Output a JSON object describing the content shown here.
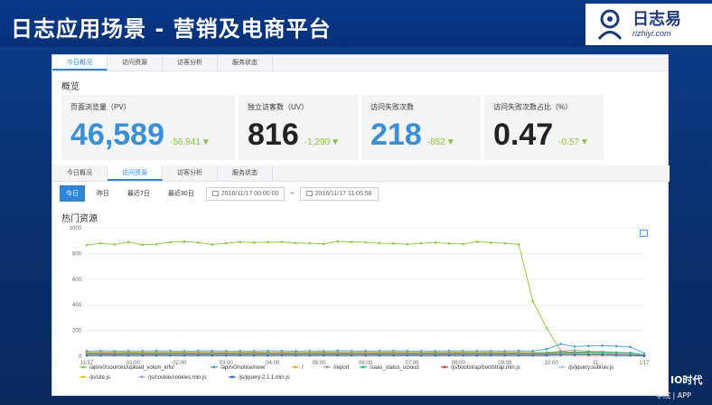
{
  "slide": {
    "title": "日志应用场景 - 营销及电商平台",
    "logo_main": "日志易",
    "logo_sub": "rizhiyi.com",
    "corner_text": "IO时代",
    "corner_sub": "学院 | APP"
  },
  "tabs": [
    "今日概况",
    "访问资源",
    "访客分析",
    "服务状态"
  ],
  "tabs_active": 0,
  "overview_title": "概览",
  "metrics": [
    {
      "label": "页面浏览量（PV）",
      "value": "46,589",
      "delta": "-56,941",
      "color": "#3a8fd6"
    },
    {
      "label": "独立访客数（UV）",
      "value": "816",
      "delta": "-1,290",
      "color": "#222222"
    },
    {
      "label": "访问失败次数",
      "value": "218",
      "delta": "-852",
      "color": "#3a8fd6"
    },
    {
      "label": "访问失败次数占比（%）",
      "value": "0.47",
      "delta": "-0.57",
      "color": "#222222"
    }
  ],
  "tabs2": [
    "今日概况",
    "访问资源",
    "访客分析",
    "服务状态"
  ],
  "tabs2_active": 1,
  "filters": {
    "today": "今日",
    "yesterday": "昨日",
    "last7": "最近7日",
    "last30": "最近30日",
    "from": "2016/11/17 00:00:00",
    "sep": "~",
    "to": "2016/11/17 11:05:58"
  },
  "chart_title": "热门资源",
  "chart_data": {
    "type": "line",
    "ylim": [
      0,
      1000
    ],
    "yticks": [
      0,
      200,
      400,
      600,
      800,
      1000
    ],
    "xticks": [
      "11/17",
      "01:00",
      "02:00",
      "03:00",
      "04:00",
      "05:00",
      "06:00",
      "07:00",
      "08:00",
      "09:00",
      "10:00",
      "11...",
      "1'17"
    ],
    "series": [
      {
        "name": "/api/v0/sources/upload_volum_info/",
        "color": "#8cc63f",
        "values": [
          865,
          880,
          870,
          890,
          868,
          872,
          888,
          892,
          885,
          870,
          880,
          890,
          885,
          888,
          890,
          882,
          880,
          875,
          895,
          890,
          888,
          880,
          878,
          872,
          880,
          885,
          878,
          874,
          892,
          884,
          880,
          870,
          430,
          220,
          40,
          25,
          20,
          18,
          15,
          12,
          10
        ]
      },
      {
        "name": "/api/v0/notice/new/",
        "color": "#3aa0d6",
        "values": [
          40,
          42,
          40,
          41,
          40,
          42,
          41,
          40,
          41,
          42,
          40,
          41,
          40,
          42,
          41,
          40,
          41,
          40,
          42,
          41,
          40,
          41,
          42,
          40,
          41,
          40,
          42,
          41,
          40,
          41,
          40,
          42,
          40,
          55,
          95,
          75,
          80,
          82,
          78,
          72,
          22
        ]
      },
      {
        "name": "/",
        "color": "#f5a623",
        "values": [
          30,
          31,
          30,
          32,
          31,
          30,
          31,
          32,
          30,
          31,
          30,
          31,
          32,
          30,
          31,
          30,
          31,
          32,
          30,
          31,
          30,
          31,
          32,
          30,
          31,
          30,
          31,
          32,
          30,
          31,
          30,
          30,
          28,
          30,
          32,
          30,
          28,
          26,
          25,
          24,
          12
        ]
      },
      {
        "name": "/report",
        "color": "#999999",
        "values": [
          25,
          25,
          26,
          25,
          25,
          26,
          25,
          25,
          26,
          25,
          25,
          26,
          25,
          25,
          26,
          25,
          25,
          26,
          25,
          25,
          26,
          25,
          25,
          26,
          25,
          25,
          26,
          25,
          25,
          26,
          25,
          25,
          24,
          25,
          40,
          45,
          38,
          35,
          30,
          28,
          10
        ]
      },
      {
        "name": "/saas_status_ucloud",
        "color": "#1abc9c",
        "values": [
          20,
          21,
          20,
          21,
          20,
          21,
          20,
          21,
          20,
          21,
          20,
          21,
          20,
          21,
          20,
          21,
          20,
          21,
          20,
          21,
          20,
          21,
          20,
          21,
          20,
          21,
          20,
          21,
          20,
          21,
          20,
          21,
          20,
          22,
          28,
          30,
          32,
          30,
          28,
          25,
          8
        ]
      },
      {
        "name": "/js/bootstrap/bootstrap.min.js",
        "color": "#d0413e",
        "values": [
          15,
          15,
          16,
          15,
          15,
          16,
          15,
          15,
          16,
          15,
          15,
          16,
          15,
          15,
          16,
          15,
          15,
          16,
          15,
          15,
          16,
          15,
          15,
          16,
          15,
          15,
          16,
          15,
          15,
          16,
          15,
          15,
          15,
          16,
          20,
          22,
          20,
          18,
          16,
          14,
          6
        ]
      },
      {
        "name": "/js/jquery.subnav.js",
        "color": "#8ec9e8",
        "values": [
          12,
          12,
          13,
          12,
          12,
          13,
          12,
          12,
          13,
          12,
          12,
          13,
          12,
          12,
          13,
          12,
          12,
          13,
          12,
          12,
          13,
          12,
          12,
          13,
          12,
          12,
          13,
          12,
          12,
          13,
          12,
          12,
          12,
          13,
          16,
          18,
          17,
          15,
          14,
          12,
          5
        ]
      },
      {
        "name": "/js/site.js",
        "color": "#f1c40f",
        "values": [
          10,
          10,
          11,
          10,
          10,
          11,
          10,
          10,
          11,
          10,
          10,
          11,
          10,
          10,
          11,
          10,
          10,
          11,
          10,
          10,
          11,
          10,
          10,
          11,
          10,
          10,
          11,
          10,
          10,
          11,
          10,
          10,
          10,
          11,
          14,
          15,
          14,
          13,
          12,
          10,
          4
        ]
      },
      {
        "name": "/js/cookie/cookies.min.js",
        "color": "#b39ddb",
        "values": [
          8,
          8,
          9,
          8,
          8,
          9,
          8,
          8,
          9,
          8,
          8,
          9,
          8,
          8,
          9,
          8,
          8,
          9,
          8,
          8,
          9,
          8,
          8,
          9,
          8,
          8,
          9,
          8,
          8,
          9,
          8,
          8,
          8,
          9,
          12,
          13,
          12,
          11,
          10,
          9,
          3
        ]
      },
      {
        "name": "/js/jquery-2.1.1.min.js",
        "color": "#2c6fb3",
        "values": [
          6,
          6,
          7,
          6,
          6,
          7,
          6,
          6,
          7,
          6,
          6,
          7,
          6,
          6,
          7,
          6,
          6,
          7,
          6,
          6,
          7,
          6,
          6,
          7,
          6,
          6,
          7,
          6,
          6,
          7,
          6,
          6,
          6,
          7,
          10,
          11,
          10,
          9,
          8,
          7,
          2
        ]
      }
    ]
  }
}
